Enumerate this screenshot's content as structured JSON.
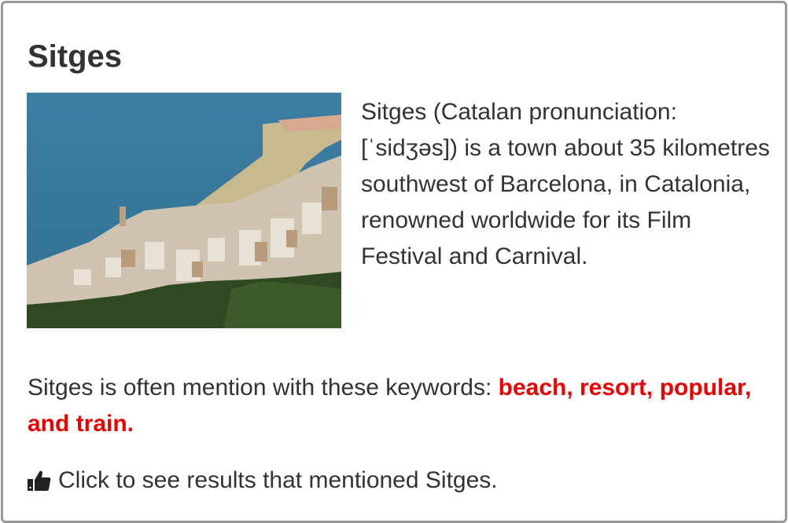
{
  "card": {
    "title": "Sitges",
    "description": "Sitges (Catalan pronunciation: [ˈsidʒəs]) is a town about 35 kilometres southwest of Barcelona, in Catalonia, renowned worldwide for its Film Festival and Carnival.",
    "keywords_prefix": "Sitges is often mention with these keywords: ",
    "keywords_text": "beach, resort, popular, and train.",
    "cta_label": "Click to see results that mentioned Sitges.",
    "cta_icon": "thumbs-up-icon",
    "photo_alt": "Sitges",
    "colors": {
      "keyword": "#ee0000",
      "border": "#999999",
      "text": "#333333"
    }
  }
}
